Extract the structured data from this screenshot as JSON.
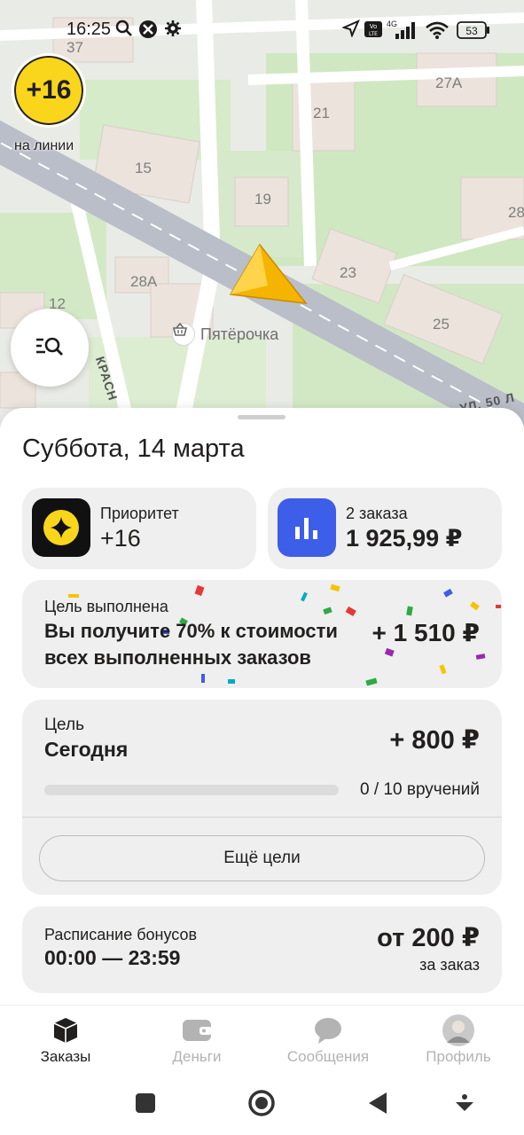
{
  "status_bar": {
    "time": "16:25",
    "battery": "53",
    "network": "4G",
    "volte": "Vo LTE"
  },
  "map": {
    "building_numbers": [
      "37",
      "21",
      "27А",
      "15",
      "19",
      "28",
      "23",
      "28А",
      "12",
      "25"
    ],
    "poi_name": "Пятёрочка",
    "street_left": "КРАСН",
    "street_right": "УЛ. 50 Л"
  },
  "priority_badge": {
    "value": "+16",
    "status": "на линии"
  },
  "sheet": {
    "title": "Суббота, 14 марта",
    "priority_card": {
      "label": "Приоритет",
      "value": "+16"
    },
    "orders_card": {
      "label": "2 заказа",
      "value": "1 925,99 ₽"
    },
    "goal_done": {
      "label": "Цель выполнена",
      "text": "Вы получите 70% к стоимости всех выполненных заказов",
      "amount": "+ 1 510 ₽"
    },
    "goal_today": {
      "label": "Цель",
      "title": "Сегодня",
      "amount": "+ 800 ₽",
      "progress": 0,
      "count_text": "0 / 10 вручений",
      "more_button": "Ещё цели"
    },
    "schedule": {
      "label": "Расписание бонусов",
      "time": "00:00 — 23:59",
      "amount": "от 200 ₽",
      "sub": "за заказ"
    }
  },
  "bottom_nav": {
    "items": [
      {
        "label": "Заказы",
        "icon": "orders-box-icon",
        "active": true
      },
      {
        "label": "Деньги",
        "icon": "wallet-icon",
        "active": false
      },
      {
        "label": "Сообщения",
        "icon": "chat-bubble-icon",
        "active": false
      },
      {
        "label": "Профиль",
        "icon": "avatar",
        "active": false
      }
    ]
  },
  "colors": {
    "accent_yellow": "#f9d51c",
    "orders_blue": "#3d5ee8",
    "card_bg": "#efefef",
    "text": "#21201f",
    "nav_inactive": "#b3b3b3"
  }
}
